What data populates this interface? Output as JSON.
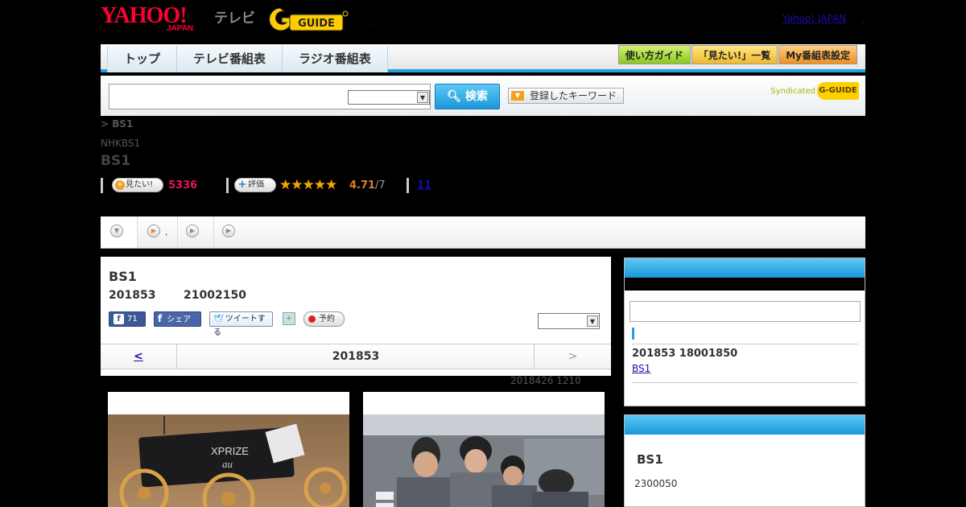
{
  "header": {
    "yahoo_logo": "YAHOO!",
    "yahoo_sub": "JAPAN",
    "tv_label": "テレビ",
    "gguide_logo": "G-GUIDE",
    "yahoo_japan_link": "Yahoo! JAPAN",
    "dot1": ",",
    "dot2": ","
  },
  "nav": {
    "tabs": [
      "トップ",
      "テレビ番組表",
      "ラジオ番組表"
    ],
    "buttons": [
      "使い方ガイド",
      "「見たい!」一覧",
      "My番組表設定"
    ],
    "colors": {
      "accent": "#22a0e0"
    }
  },
  "search": {
    "placeholder": "",
    "button_label": "検索",
    "keyword_button": "登録したキーワード",
    "syndicated": "Syndicated",
    "syndicated_logo": "G-GUIDE"
  },
  "breadcrumb": "> BS1",
  "channel": {
    "sub": "NHKBS1",
    "title": "BS1"
  },
  "stats": {
    "want_label": "見たい!",
    "want_count": "5336",
    "rate_label": "評価",
    "stars": "★★★★★",
    "rating_value": 4.71,
    "rating": "4.71",
    "rating_max": "/7",
    "reviews": "11"
  },
  "subtabs": [
    {
      "label": "",
      "icon": "chevron-down-icon"
    },
    {
      "label": ",",
      "icon": "play-icon"
    },
    {
      "label": "",
      "icon": "play-icon"
    },
    {
      "label": "",
      "icon": "play-icon"
    }
  ],
  "program": {
    "title": "BS1",
    "date": "201853",
    "time": "21002150",
    "fb_like_count": "71",
    "fb_share": "シェア",
    "tweet": "ツイートする",
    "record": "予約",
    "nav_prev": "<",
    "nav_date": "201853",
    "nav_next": ">",
    "updated": "2018426  1210"
  },
  "sidebar": {
    "next_when": "201853  18001850",
    "next_link": "BS1",
    "channel_title": "BS1",
    "channel_value": "2300050"
  }
}
